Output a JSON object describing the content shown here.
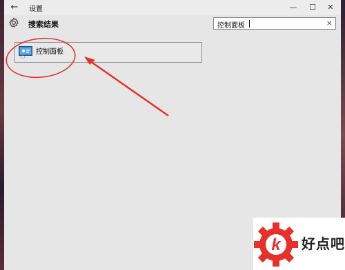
{
  "window": {
    "title": "设置",
    "back_glyph": "←",
    "minimize_glyph": "—",
    "maximize_glyph": "☐",
    "close_glyph": "✕"
  },
  "header": {
    "icon": "gear-icon",
    "title": "搜索结果"
  },
  "search": {
    "value": "控制面板",
    "clear_glyph": "×"
  },
  "results": [
    {
      "label": "控制面板",
      "icon": "control-panel-icon"
    }
  ],
  "annotation": {
    "color": "#e8302a"
  },
  "watermark": {
    "text": "好点吧",
    "logo_letter": "k",
    "color": "#e8302a"
  }
}
